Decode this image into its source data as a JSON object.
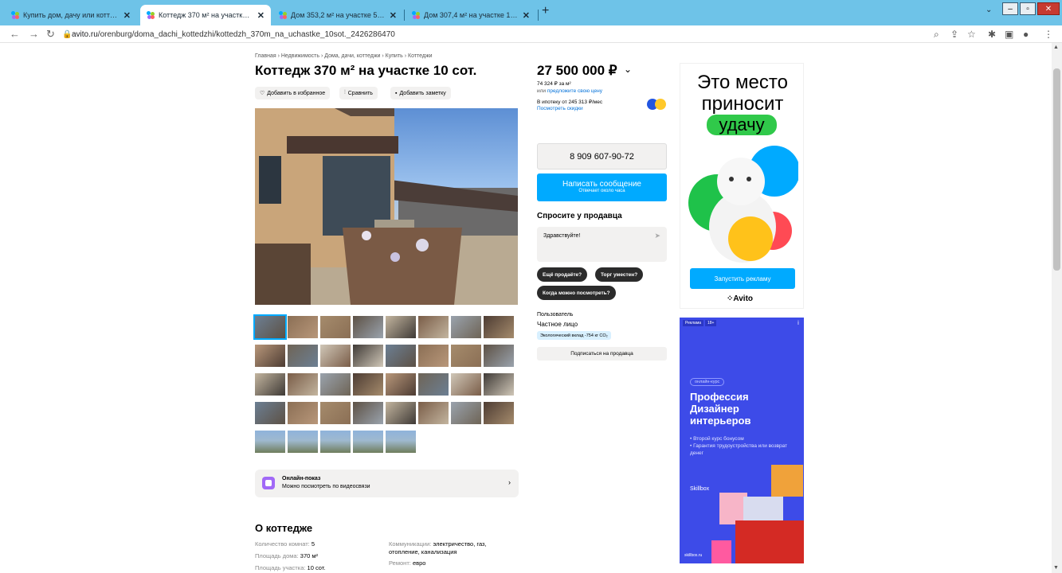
{
  "browser": {
    "tabs": [
      {
        "title": "Купить дом, дачу или коттедж в",
        "active": false
      },
      {
        "title": "Коттедж 370 м² на участке 10 со",
        "active": true
      },
      {
        "title": "Дом 353,2 м² на участке 5 сот. -",
        "active": false
      },
      {
        "title": "Дом 307,4 м² на участке 10 сот.",
        "active": false
      }
    ],
    "new_tab": "+",
    "close_glyph": "✕",
    "url_host": "avito.ru",
    "url_path": "/orenburg/doma_dachi_kottedzhi/kottedzh_370m_na_uchastke_10sot._2426286470",
    "window_controls": {
      "minimize": "–",
      "maximize": "▫",
      "close": "✕"
    }
  },
  "listing": {
    "breadcrumbs": "Главная › Недвижимость › Дома, дачи, коттеджи › Купить › Коттеджи",
    "title": "Коттедж 370 м² на участке 10 сот.",
    "actions": {
      "favorite": "Добавить в избранное",
      "compare": "Сравнить",
      "note": "Добавить заметку"
    },
    "thumbnail_count": 37,
    "online_show": {
      "title": "Онлайн-показ",
      "subtitle": "Можно посмотреть по видеосвязи"
    },
    "about": {
      "heading": "О коттедже",
      "props_left": [
        {
          "label": "Количество комнат:",
          "value": "5"
        },
        {
          "label": "Площадь дома:",
          "value": "370 м²"
        },
        {
          "label": "Площадь участка:",
          "value": "10 сот."
        }
      ],
      "props_right": [
        {
          "label": "Коммуникации:",
          "value": "электричество, газ, отопление, канализация"
        },
        {
          "label": "Ремонт:",
          "value": "евро"
        }
      ]
    }
  },
  "seller": {
    "price": "27 500 000 ₽",
    "price_per_m": "74 324 ₽ за м²",
    "offer_prefix": "или",
    "offer_link": "предложите свою цену",
    "mortgage": "В ипотеку от 245 313 ₽/мес",
    "discounts_link": "Посмотреть скидки",
    "phone": "8 909 607-90-72",
    "message_button": "Написать сообщение",
    "message_sub": "Отвечает около часа",
    "ask_heading": "Спросите у продавца",
    "ask_placeholder": "Здравствуйте!",
    "quick_questions": [
      "Ещё продаёте?",
      "Торг уместен?",
      "Когда можно посмотреть?"
    ],
    "user_type": "Пользователь",
    "user_name": "Частное лицо",
    "eco_badge": "Экологический вклад -754 кг CO₂",
    "subscribe": "Подписаться на продавца"
  },
  "ads": {
    "ad1": {
      "line1": "Это место",
      "line2": "приносит",
      "line3": "удачу",
      "cta": "Запустить рекламу",
      "brand": "Avito"
    },
    "ad2": {
      "tag": "Реклама",
      "age": "18+",
      "chip": "онлайн-курс",
      "title": "Профессия Дизайнер интерьеров",
      "bullet1": "Второй курс бонусом",
      "bullet2": "Гарантия трудоустройства или возврат денег",
      "brand": "Skillbox",
      "footer": "skillbox.ru"
    }
  }
}
